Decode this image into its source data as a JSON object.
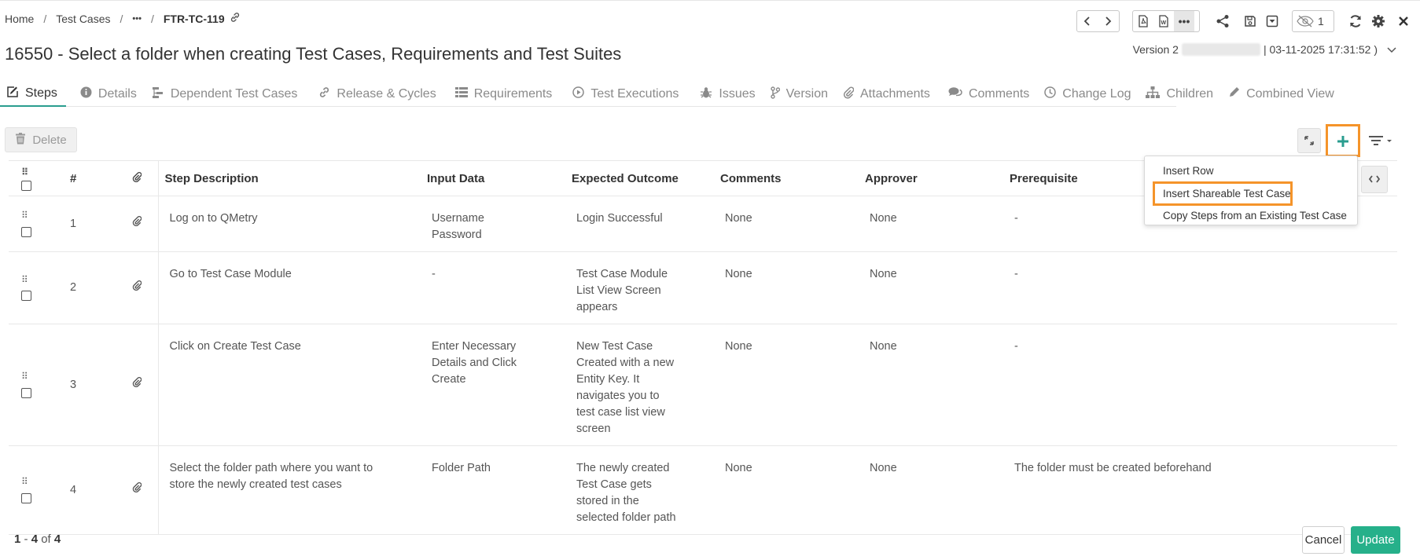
{
  "breadcrumb": {
    "home": "Home",
    "section": "Test Cases",
    "ellipsis": "•••",
    "current": "FTR-TC-119"
  },
  "toolbar": {
    "watchers_count": "1"
  },
  "title": "16550 - Select a folder when creating Test Cases, Requirements and Test Suites",
  "version": {
    "label": "Version 2",
    "date": "| 03-11-2025 17:31:52 )",
    "chevron": "⌄"
  },
  "tabs": [
    {
      "label": "Steps",
      "icon": "edit-icon"
    },
    {
      "label": "Details",
      "icon": "info-icon"
    },
    {
      "label": "Dependent Test Cases",
      "icon": "hierarchy-icon"
    },
    {
      "label": "Release & Cycles",
      "icon": "link-icon"
    },
    {
      "label": "Requirements",
      "icon": "list-icon"
    },
    {
      "label": "Test Executions",
      "icon": "play-icon"
    },
    {
      "label": "Issues",
      "icon": "bug-icon"
    },
    {
      "label": "Version",
      "icon": "branch-icon"
    },
    {
      "label": "Attachments",
      "icon": "paperclip-icon"
    },
    {
      "label": "Comments",
      "icon": "comments-icon"
    },
    {
      "label": "Change Log",
      "icon": "clock-icon"
    },
    {
      "label": "Children",
      "icon": "sitemap-icon"
    },
    {
      "label": "Combined View",
      "icon": "pencil-icon"
    }
  ],
  "actions": {
    "delete": "Delete",
    "cancel": "Cancel",
    "update": "Update"
  },
  "table": {
    "headers": {
      "number": "#",
      "description": "Step Description",
      "input": "Input Data",
      "expected": "Expected Outcome",
      "comments": "Comments",
      "approver": "Approver",
      "prerequisite": "Prerequisite"
    },
    "rows": [
      {
        "n": "1",
        "description": "Log on to QMetry",
        "input": "Username\nPassword",
        "expected": "Login Successful",
        "comments": "None",
        "approver": "None",
        "prerequisite": "-"
      },
      {
        "n": "2",
        "description": "Go to Test Case Module",
        "input": "-",
        "expected": "Test Case Module\nList View Screen\nappears",
        "comments": "None",
        "approver": "None",
        "prerequisite": "-"
      },
      {
        "n": "3",
        "description": "Click on Create Test Case",
        "input": "Enter Necessary\nDetails and Click\nCreate",
        "expected": "New Test Case\nCreated with a new\nEntity Key. It\nnavigates you to\ntest case list view\nscreen",
        "comments": "None",
        "approver": "None",
        "prerequisite": "-"
      },
      {
        "n": "4",
        "description": "Select the folder path where you want to\nstore the newly created test cases",
        "input": "Folder Path",
        "expected": "The newly created\nTest Case gets\nstored in the\nselected folder path",
        "comments": "None",
        "approver": "None",
        "prerequisite": "The folder must be created beforehand"
      }
    ]
  },
  "menu": {
    "insert_row": "Insert Row",
    "insert_shareable": "Insert Shareable Test Case",
    "copy_steps": "Copy Steps from an Existing Test Case"
  },
  "pager": {
    "from": "1",
    "dash": " - ",
    "to": "4",
    "of": " of ",
    "total": "4"
  },
  "colors": {
    "accent": "#2a9d8f",
    "highlight": "#f5942a",
    "update": "#26b08a"
  }
}
